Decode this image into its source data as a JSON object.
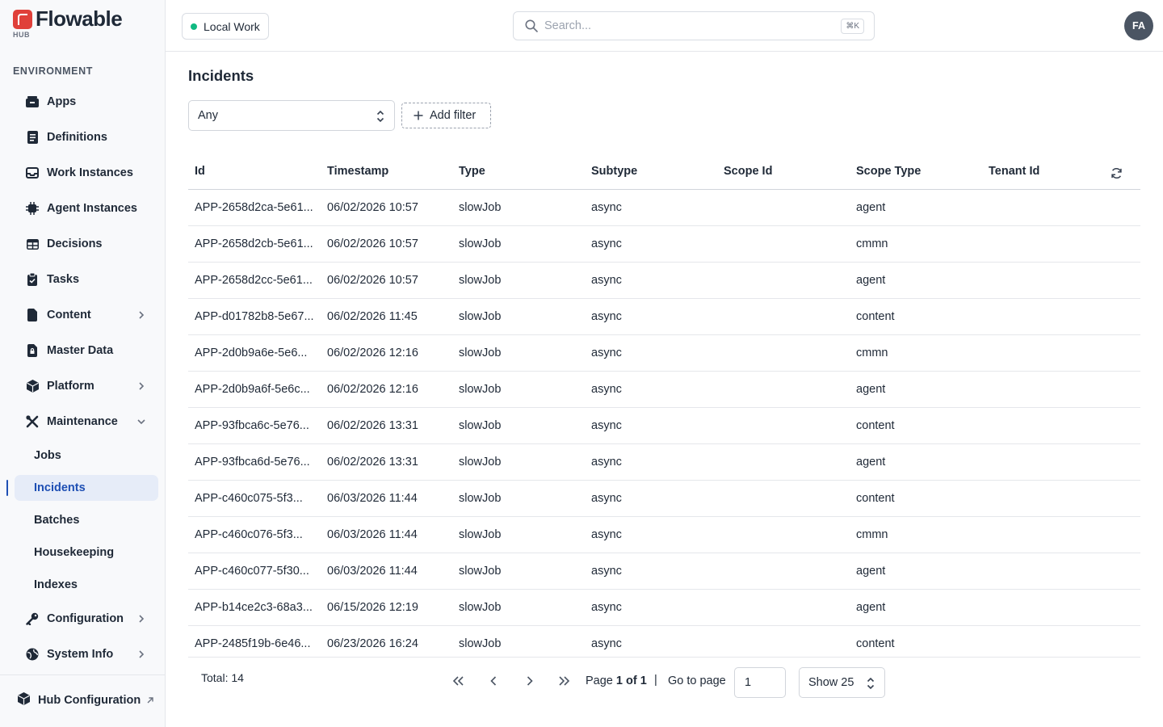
{
  "brand": {
    "name": "Flowable",
    "sub": "HUB",
    "color": "#e0403a"
  },
  "sidebar": {
    "section_label": "ENVIRONMENT",
    "items": [
      {
        "label": "Apps",
        "icon": "apps-icon"
      },
      {
        "label": "Definitions",
        "icon": "definitions-icon"
      },
      {
        "label": "Work Instances",
        "icon": "inbox-icon"
      },
      {
        "label": "Agent Instances",
        "icon": "chip-icon"
      },
      {
        "label": "Decisions",
        "icon": "table-icon"
      },
      {
        "label": "Tasks",
        "icon": "clipboard-check-icon"
      },
      {
        "label": "Content",
        "icon": "document-icon",
        "expandable": true
      },
      {
        "label": "Master Data",
        "icon": "document-lock-icon"
      },
      {
        "label": "Platform",
        "icon": "cube-icon",
        "expandable": true
      },
      {
        "label": "Maintenance",
        "icon": "wrench-screwdriver-icon",
        "expanded": true
      },
      {
        "label": "Configuration",
        "icon": "key-icon",
        "expandable": true
      },
      {
        "label": "System Info",
        "icon": "globe-icon",
        "expandable": true
      }
    ],
    "maintenance_sub": [
      {
        "label": "Jobs"
      },
      {
        "label": "Incidents",
        "active": true
      },
      {
        "label": "Batches"
      },
      {
        "label": "Housekeeping"
      },
      {
        "label": "Indexes"
      }
    ],
    "footer": {
      "label": "Hub Configuration"
    }
  },
  "topbar": {
    "environment": "Local Work",
    "search_placeholder": "Search...",
    "search_shortcut": "⌘K",
    "avatar_initials": "FA"
  },
  "main": {
    "title": "Incidents",
    "filter_value": "Any",
    "add_filter_label": "Add filter",
    "columns": [
      "Id",
      "Timestamp",
      "Type",
      "Subtype",
      "Scope Id",
      "Scope Type",
      "Tenant Id"
    ],
    "rows": [
      {
        "id": "APP-2658d2ca-5e61...",
        "timestamp": "06/02/2026 10:57",
        "type": "slowJob",
        "subtype": "async",
        "scope_id": "",
        "scope_type": "agent",
        "tenant_id": ""
      },
      {
        "id": "APP-2658d2cb-5e61...",
        "timestamp": "06/02/2026 10:57",
        "type": "slowJob",
        "subtype": "async",
        "scope_id": "",
        "scope_type": "cmmn",
        "tenant_id": ""
      },
      {
        "id": "APP-2658d2cc-5e61...",
        "timestamp": "06/02/2026 10:57",
        "type": "slowJob",
        "subtype": "async",
        "scope_id": "",
        "scope_type": "agent",
        "tenant_id": ""
      },
      {
        "id": "APP-d01782b8-5e67...",
        "timestamp": "06/02/2026 11:45",
        "type": "slowJob",
        "subtype": "async",
        "scope_id": "",
        "scope_type": "content",
        "tenant_id": ""
      },
      {
        "id": "APP-2d0b9a6e-5e6...",
        "timestamp": "06/02/2026 12:16",
        "type": "slowJob",
        "subtype": "async",
        "scope_id": "",
        "scope_type": "cmmn",
        "tenant_id": ""
      },
      {
        "id": "APP-2d0b9a6f-5e6c...",
        "timestamp": "06/02/2026 12:16",
        "type": "slowJob",
        "subtype": "async",
        "scope_id": "",
        "scope_type": "agent",
        "tenant_id": ""
      },
      {
        "id": "APP-93fbca6c-5e76...",
        "timestamp": "06/02/2026 13:31",
        "type": "slowJob",
        "subtype": "async",
        "scope_id": "",
        "scope_type": "content",
        "tenant_id": ""
      },
      {
        "id": "APP-93fbca6d-5e76...",
        "timestamp": "06/02/2026 13:31",
        "type": "slowJob",
        "subtype": "async",
        "scope_id": "",
        "scope_type": "agent",
        "tenant_id": ""
      },
      {
        "id": "APP-c460c075-5f3...",
        "timestamp": "06/03/2026 11:44",
        "type": "slowJob",
        "subtype": "async",
        "scope_id": "",
        "scope_type": "content",
        "tenant_id": ""
      },
      {
        "id": "APP-c460c076-5f3...",
        "timestamp": "06/03/2026 11:44",
        "type": "slowJob",
        "subtype": "async",
        "scope_id": "",
        "scope_type": "cmmn",
        "tenant_id": ""
      },
      {
        "id": "APP-c460c077-5f30...",
        "timestamp": "06/03/2026 11:44",
        "type": "slowJob",
        "subtype": "async",
        "scope_id": "",
        "scope_type": "agent",
        "tenant_id": ""
      },
      {
        "id": "APP-b14ce2c3-68a3...",
        "timestamp": "06/15/2026 12:19",
        "type": "slowJob",
        "subtype": "async",
        "scope_id": "",
        "scope_type": "agent",
        "tenant_id": ""
      },
      {
        "id": "APP-2485f19b-6e46...",
        "timestamp": "06/23/2026 16:24",
        "type": "slowJob",
        "subtype": "async",
        "scope_id": "",
        "scope_type": "content",
        "tenant_id": ""
      }
    ]
  },
  "pagination": {
    "total_label": "Total: 14",
    "page_prefix": "Page",
    "page_current": "1 of 1",
    "separator": "|",
    "goto_label": "Go to page",
    "goto_value": "1",
    "show_label": "Show 25"
  },
  "colors": {
    "accent": "#1e4fb4",
    "status_dot": "#10b981"
  }
}
